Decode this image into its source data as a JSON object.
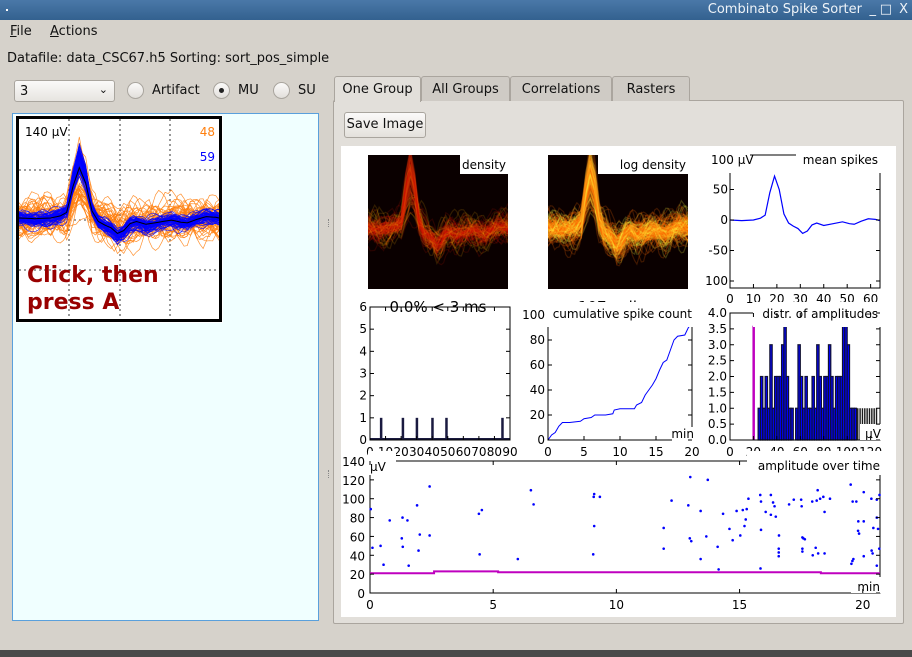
{
  "window": {
    "title": "Combinato Spike Sorter",
    "minimize": "_",
    "maximize": "□",
    "close": "X",
    "bar_color": "#3d6b9b"
  },
  "menu": {
    "items": [
      "File",
      "Actions"
    ]
  },
  "info": {
    "datafile_text": "Datafile: data_CSC67.h5 Sorting: sort_pos_simple"
  },
  "controls": {
    "group_select": "3",
    "radios": [
      {
        "label": "Artifact",
        "checked": false
      },
      {
        "label": "MU",
        "checked": true
      },
      {
        "label": "SU",
        "checked": false
      }
    ]
  },
  "waveform_panel": {
    "scale_label": "140 µV",
    "count_orange": "48",
    "count_blue": "59",
    "hint_line1": "Click, then",
    "hint_line2": "press A",
    "colors": {
      "orange": "#ff7f0e",
      "blue": "#0000ff",
      "hint": "#990000"
    }
  },
  "tabs": [
    {
      "label": "One Group",
      "active": true
    },
    {
      "label": "All Groups",
      "active": false
    },
    {
      "label": "Correlations",
      "active": false
    },
    {
      "label": "Rasters",
      "active": false
    }
  ],
  "toolbar": {
    "save_image": "Save Image"
  },
  "chart_data": [
    {
      "id": "density",
      "type": "heatmap",
      "title": "density",
      "caption": "0.0% < 3 ms",
      "colormap": "hot"
    },
    {
      "id": "log_density",
      "type": "heatmap",
      "title": "log density",
      "caption": "107 spikes",
      "colormap": "hot"
    },
    {
      "id": "mean_spikes",
      "type": "line",
      "title": "mean spikes",
      "xlim": [
        0,
        64
      ],
      "ylim": [
        -110,
        105
      ],
      "xticks": [
        0,
        10,
        20,
        30,
        40,
        50,
        60
      ],
      "yticks": [
        {
          "v": 100,
          "label": "100 µV"
        },
        {
          "v": 50,
          "label": "50"
        },
        {
          "v": 0,
          "label": "0"
        },
        {
          "v": -50,
          "label": "-50"
        },
        {
          "v": -100,
          "label": "100"
        }
      ],
      "color": "#0000ff",
      "x": [
        0,
        5,
        10,
        13,
        15,
        17,
        19,
        21,
        23,
        25,
        27,
        29,
        31,
        33,
        35,
        37,
        40,
        44,
        48,
        51,
        53,
        56,
        59,
        62,
        64
      ],
      "y": [
        0,
        -1,
        0,
        3,
        8,
        45,
        72,
        50,
        10,
        -5,
        -10,
        -14,
        -22,
        -18,
        -8,
        -5,
        -9,
        -6,
        -3,
        -6,
        -7,
        -2,
        2,
        1,
        -1
      ]
    },
    {
      "id": "isi",
      "type": "bar",
      "xlim": [
        0,
        90
      ],
      "ylim": [
        0,
        6
      ],
      "xticks": [
        0,
        10,
        20,
        30,
        40,
        50,
        60,
        70,
        80,
        90
      ],
      "yticks": [
        0,
        1,
        2,
        3,
        4,
        5,
        6
      ],
      "x": [
        7,
        21,
        30,
        40,
        49,
        85
      ],
      "values": [
        1,
        1,
        1,
        1,
        1,
        1
      ]
    },
    {
      "id": "cumulative",
      "type": "line",
      "title": "cumulative spike count",
      "xlabel": "min",
      "xlim": [
        0,
        20
      ],
      "ylim": [
        0,
        100
      ],
      "xticks": [
        0,
        5,
        10,
        15,
        20
      ],
      "yticks": [
        0,
        20,
        40,
        60,
        80,
        100
      ],
      "color": "#0000ff",
      "x": [
        0,
        0.5,
        1,
        1.5,
        2,
        3,
        4.5,
        5,
        6,
        6.5,
        8,
        9,
        9.2,
        10,
        12,
        12.3,
        13,
        13.5,
        14,
        14.5,
        15,
        15.5,
        16,
        16.5,
        17,
        17.5,
        18,
        19,
        19.5,
        20
      ],
      "y": [
        0,
        4,
        6,
        11,
        14,
        14,
        15,
        17,
        18,
        20,
        20,
        21,
        24,
        25,
        25,
        28,
        30,
        36,
        40,
        44,
        49,
        56,
        62,
        64,
        72,
        80,
        83,
        84,
        90,
        93
      ]
    },
    {
      "id": "amplitude_distribution",
      "type": "bar",
      "title": "distr. of amplitudes",
      "xlabel": "µV",
      "xlim": [
        0,
        128
      ],
      "ylim": [
        0,
        4
      ],
      "xticks": [
        0,
        20,
        40,
        60,
        80,
        100,
        120
      ],
      "yticks": [
        "0.0",
        "0.5",
        "1.0",
        "1.5",
        "2.0",
        "2.5",
        "3.0",
        "3.5",
        "4.0"
      ],
      "threshold": 20,
      "threshold_color": "#bf00bf",
      "bin_width": 2,
      "bin_starts": [
        24,
        26,
        28,
        30,
        32,
        34,
        36,
        38,
        40,
        42,
        44,
        46,
        48,
        50,
        52,
        56,
        58,
        60,
        62,
        64,
        66,
        68,
        70,
        72,
        74,
        76,
        78,
        80,
        82,
        84,
        86,
        88,
        90,
        92,
        94,
        96,
        98,
        100,
        102,
        104,
        106
      ],
      "values": [
        1,
        2,
        1,
        2,
        1,
        3,
        1,
        2,
        2,
        2,
        3,
        3.6,
        2,
        1,
        1,
        1,
        3,
        2,
        1,
        2,
        1,
        1,
        2,
        1,
        3,
        2,
        1,
        2,
        2,
        3,
        2,
        1,
        2,
        2,
        2,
        3.6,
        3.6,
        3,
        1,
        1,
        1
      ],
      "tail_bins": [
        108,
        110,
        112,
        114,
        116,
        118,
        120,
        122,
        124
      ],
      "tail_values": [
        1,
        1,
        1,
        1,
        1,
        1,
        1,
        1,
        1
      ]
    },
    {
      "id": "amplitude_over_time",
      "type": "scatter",
      "title": "amplitude over time",
      "xlabel": "min",
      "ylabel": "µV",
      "xlim": [
        0,
        20.7
      ],
      "ylim": [
        0,
        140
      ],
      "xticks": [
        0,
        5,
        10,
        15,
        20
      ],
      "yticks": [
        0,
        20,
        40,
        60,
        80,
        100,
        120,
        140
      ],
      "color": "#0000ff",
      "points": [
        [
          0.03,
          89
        ],
        [
          0.1,
          48
        ],
        [
          0.43,
          50
        ],
        [
          0.55,
          30
        ],
        [
          0.8,
          77
        ],
        [
          1.29,
          58
        ],
        [
          1.32,
          80
        ],
        [
          1.33,
          49
        ],
        [
          1.52,
          77
        ],
        [
          1.57,
          29
        ],
        [
          1.91,
          93
        ],
        [
          1.97,
          45
        ],
        [
          2.02,
          62
        ],
        [
          2.42,
          113
        ],
        [
          2.42,
          61
        ],
        [
          4.42,
          84
        ],
        [
          4.45,
          41
        ],
        [
          4.54,
          88
        ],
        [
          6.0,
          36
        ],
        [
          6.53,
          109
        ],
        [
          6.64,
          94
        ],
        [
          9.06,
          41
        ],
        [
          9.1,
          71
        ],
        [
          9.1,
          105
        ],
        [
          9.08,
          102
        ],
        [
          9.33,
          102
        ],
        [
          11.92,
          69
        ],
        [
          11.92,
          47
        ],
        [
          12.24,
          98
        ],
        [
          12.92,
          93
        ],
        [
          13.0,
          123
        ],
        [
          12.98,
          58
        ],
        [
          13.04,
          55
        ],
        [
          13.42,
          87
        ],
        [
          13.42,
          36
        ],
        [
          13.65,
          60
        ],
        [
          13.71,
          120
        ],
        [
          14.11,
          49
        ],
        [
          14.15,
          25
        ],
        [
          14.33,
          84
        ],
        [
          14.59,
          68
        ],
        [
          14.72,
          56
        ],
        [
          14.88,
          87
        ],
        [
          15.03,
          61
        ],
        [
          15.13,
          88
        ],
        [
          15.2,
          71
        ],
        [
          15.25,
          78
        ],
        [
          15.29,
          89
        ],
        [
          15.36,
          100
        ],
        [
          15.84,
          104
        ],
        [
          15.87,
          97
        ],
        [
          15.87,
          67
        ],
        [
          15.85,
          26
        ],
        [
          16.06,
          86
        ],
        [
          16.27,
          104
        ],
        [
          16.27,
          83
        ],
        [
          16.36,
          96
        ],
        [
          16.42,
          92
        ],
        [
          16.47,
          81
        ],
        [
          16.6,
          61
        ],
        [
          16.59,
          47
        ],
        [
          16.59,
          43
        ],
        [
          16.59,
          39
        ],
        [
          17.01,
          94
        ],
        [
          17.2,
          99
        ],
        [
          17.5,
          99
        ],
        [
          17.52,
          92
        ],
        [
          17.55,
          59
        ],
        [
          17.59,
          58
        ],
        [
          17.65,
          57
        ],
        [
          17.55,
          47
        ],
        [
          17.55,
          44
        ],
        [
          17.95,
          97
        ],
        [
          17.97,
          40
        ],
        [
          18.09,
          48
        ],
        [
          18.13,
          98
        ],
        [
          18.17,
          109
        ],
        [
          18.19,
          42
        ],
        [
          18.27,
          100
        ],
        [
          18.4,
          102
        ],
        [
          18.45,
          86
        ],
        [
          18.45,
          42
        ],
        [
          18.67,
          100
        ],
        [
          19.51,
          115
        ],
        [
          19.54,
          31
        ],
        [
          19.58,
          34
        ],
        [
          19.62,
          36
        ],
        [
          19.59,
          97
        ],
        [
          19.74,
          97
        ],
        [
          19.81,
          66
        ],
        [
          19.85,
          63
        ],
        [
          19.82,
          76
        ],
        [
          20.04,
          107
        ],
        [
          20.04,
          76
        ],
        [
          20.04,
          39
        ],
        [
          20.35,
          100
        ],
        [
          20.36,
          45
        ],
        [
          20.4,
          42
        ],
        [
          20.43,
          69
        ],
        [
          20.57,
          99
        ],
        [
          20.57,
          80
        ],
        [
          20.62,
          68
        ],
        [
          20.57,
          29
        ],
        [
          20.67,
          47
        ],
        [
          20.68,
          104
        ]
      ],
      "threshold": {
        "color": "#bf00bf",
        "x": [
          0,
          2.6,
          2.6,
          5.2,
          5.2,
          18.3,
          18.3,
          20.7
        ],
        "y": [
          21,
          21,
          23,
          23,
          22,
          22,
          21,
          21
        ]
      }
    }
  ]
}
